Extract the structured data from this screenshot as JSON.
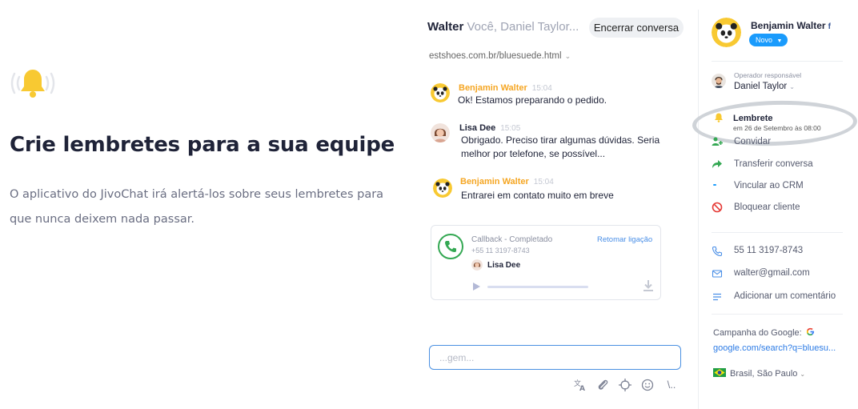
{
  "promo": {
    "title": "Crie lembretes para a sua equipe",
    "description": "O aplicativo do JivoChat irá alertá-los sobre seus lembretes para que nunca deixem nada passar."
  },
  "chat": {
    "title_name": "Walter",
    "title_participants": "Você, Daniel Taylor...",
    "end_button": "Encerrar conversa",
    "page_url": "estshoes.com.br/bluesuede.html",
    "messages": [
      {
        "author": "Benjamin Walter",
        "time": "15:04",
        "text": "Ok! Estamos preparando o pedido."
      },
      {
        "author": "Lisa Dee",
        "time": "15:05",
        "text": "Obrigado. Preciso tirar algumas dúvidas. Seria melhor por telefone, se possível..."
      },
      {
        "author": "Benjamin Walter",
        "time": "15:04",
        "text": "Entrarei em contato muito em breve"
      }
    ],
    "callback": {
      "title": "Callback - Completado",
      "phone": "+55 11 3197-8743",
      "retry": "Retomar ligação",
      "agent": "Lisa Dee",
      "progress": 0
    },
    "compose_placeholder": "...gem...",
    "tool_icons": [
      "translate-icon",
      "attach-icon",
      "target-icon",
      "emoji-icon",
      "more-icon"
    ]
  },
  "sidebar": {
    "client_name": "Benjamin Walter",
    "social": "f",
    "status_badge": "Novo",
    "operator_label": "Operador responsável",
    "operator_name": "Daniel Taylor",
    "reminder_title": "Lembrete",
    "reminder_date": "em 26 de Setembro  às 08:00",
    "actions": [
      {
        "label": "Convidar",
        "icon": "invite-icon"
      },
      {
        "label": "Transferir conversa",
        "icon": "transfer-icon"
      },
      {
        "label": "Vincular ao CRM",
        "icon": "crm-icon"
      },
      {
        "label": "Bloquear cliente",
        "icon": "block-icon"
      }
    ],
    "phone": "55 11 3197-8743",
    "email": "walter@gmail.com",
    "comment": "Adicionar um comentário",
    "campaign_label": "Campanha do Google:",
    "campaign_link": "google.com/search?q=bluesu...",
    "location": "Brasil, São Paulo"
  },
  "colors": {
    "agent_name": "#f5a623",
    "accent_blue": "#1a9bfc",
    "link_blue": "#2c7be5",
    "bell_yellow": "#f8c932"
  }
}
